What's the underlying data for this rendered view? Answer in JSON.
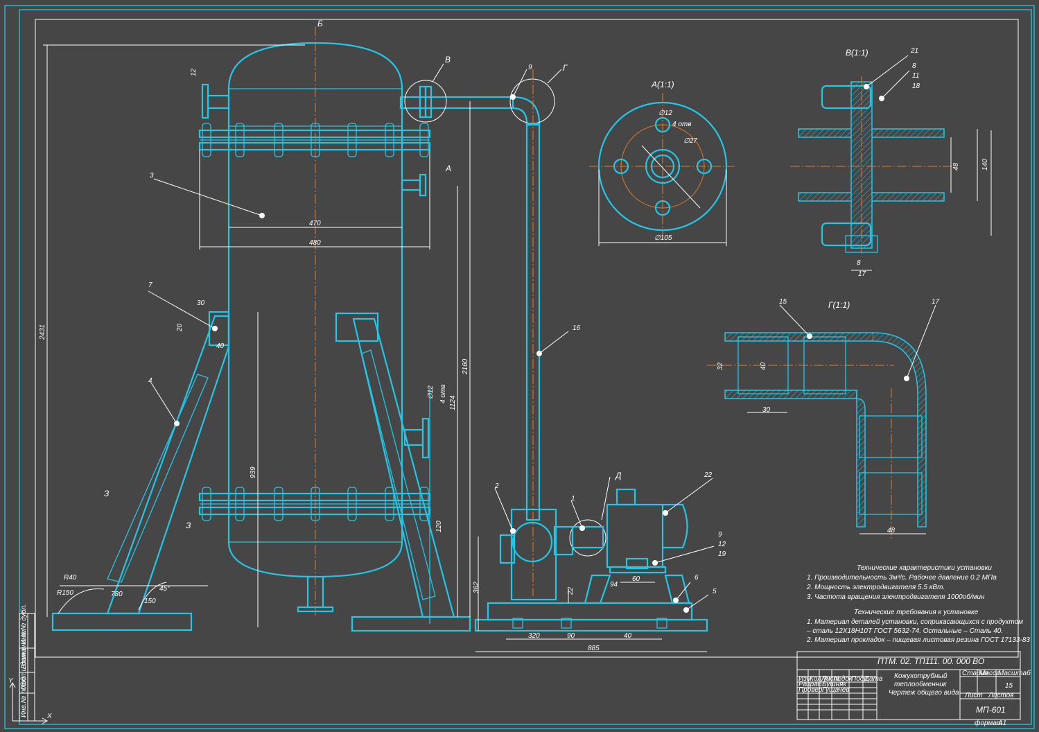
{
  "sheet": {
    "format_label": "формат",
    "format_value": "А1"
  },
  "title_block": {
    "designation": "ПТМ. 02. ТП111. 00. 000 ВО",
    "name_line1": "Кожухотрубный",
    "name_line2": "теплообменник",
    "name_line3": "Чертеж общего вида",
    "stage_label": "Стадия",
    "mass_label": "Масса",
    "scale_label": "Масштаб",
    "scale_value": "15",
    "sheet_label": "Лист",
    "sheets_label": "Листов",
    "org": "МП-601",
    "col_izm": "Изм",
    "col_list": "Кол.уч",
    "col_doc": "Лист",
    "col_ndoc": "№док",
    "col_sign": "Подп",
    "col_date": "Дата",
    "row_razrab": "Разраб",
    "row_razrab_name": "Бушняк",
    "row_prov": "Провер",
    "row_prov_name": "Гущачев"
  },
  "side_stamp": [
    "Инв.№ подл.",
    "Подп.и дата",
    "Взам.инв.№",
    "Инв.№ дубл.",
    "Подп.и дата"
  ],
  "views": {
    "section_A": "А(1:1)",
    "section_V": "В(1:1)",
    "section_G": "Г(1:1)",
    "mark_B": "Б",
    "mark_A": "А",
    "mark_V": "В",
    "mark_G": "Г",
    "mark_D": "Д",
    "mark_Z1": "З",
    "mark_Z2": "З"
  },
  "callouts": [
    "1",
    "2",
    "3",
    "4",
    "5",
    "6",
    "7",
    "9",
    "16",
    "22",
    "9",
    "12",
    "19",
    "8",
    "11",
    "18",
    "21",
    "15",
    "17"
  ],
  "dimensions": {
    "d12_a": "∅12",
    "holes": "4 отв",
    "d27": "∅27",
    "d105": "∅105",
    "d12_v": "∅12",
    "holes_v": "4 отв",
    "overall_h": "2431",
    "w470": "470",
    "w480": "480",
    "w30a": "30",
    "d12b": "12",
    "d40": "40",
    "h20": "20",
    "h939": "939",
    "h2160": "2160",
    "h1124": "1124",
    "h362": "362",
    "w320": "320",
    "w90": "90",
    "w40": "40",
    "w885": "885",
    "w94": "94",
    "h22": "22",
    "w60": "60",
    "w30g": "30",
    "d40g": "40",
    "d32g": "32",
    "d88": "48",
    "d48v": "48",
    "d140": "140",
    "w17": "17",
    "w8": "8",
    "r150": "R150",
    "a45": "45°",
    "r40": "R40",
    "w150": "150",
    "w780": "780",
    "w120": "120"
  },
  "specs": {
    "title": "Технические характеристики установки",
    "items": [
      "1. Производительность 3м³/с. Рабочее давление 0.2 МПа",
      "2. Мощность электродвигателя 5.5 кВт.",
      "3. Частота вращения электродвигателя 1000об/мин"
    ]
  },
  "requirements": {
    "title": "Технические требования к установке",
    "items": [
      "1. Материал деталей установки, соприкасающихся с продуктом",
      "– сталь 12Х18Н10Т ГОСТ 5632-74. Остальные – Сталь 40.",
      "2. Материал прокладок – пищевая листовая резина ГОСТ 17133-83"
    ]
  }
}
